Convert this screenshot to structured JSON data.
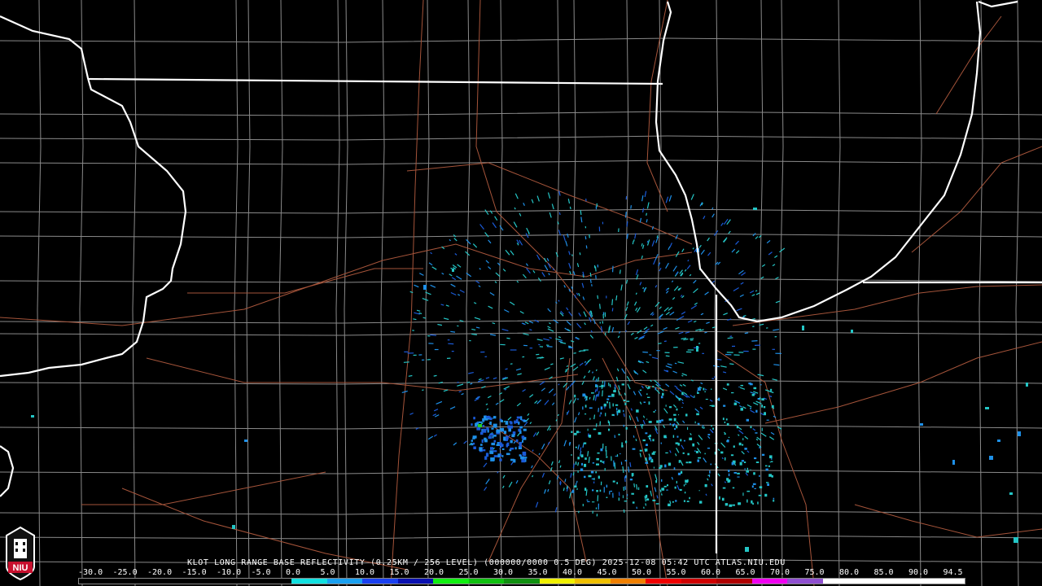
{
  "title": "KLOT LONG RANGE BASE REFLECTIVITY (0.25KM / 256 LEVEL) (000000/0000 0.5 DEG) 2025-12-08 05:42 UTC  ATLAS.NIU.EDU",
  "logo": {
    "text": "NIU",
    "color": "#c8102e"
  },
  "scale": {
    "labels": [
      "-30.0",
      "-25.0",
      "-20.0",
      "-15.0",
      "-10.0",
      "-5.0",
      "0.0",
      "5.0",
      "10.0",
      "15.0",
      "20.0",
      "25.0",
      "30.0",
      "35.0",
      "40.0",
      "45.0",
      "50.0",
      "55.0",
      "60.0",
      "65.0",
      "70.0",
      "75.0",
      "80.0",
      "85.0",
      "90.0",
      "94.5"
    ],
    "colors": [
      "#000000",
      "#000000",
      "#000000",
      "#000000",
      "#000000",
      "#000000",
      "#11e0e0",
      "#1aa0f0",
      "#1a40f0",
      "#0a10b0",
      "#10f010",
      "#10c010",
      "#109010",
      "#f0f000",
      "#f0c000",
      "#f08000",
      "#f00000",
      "#d00000",
      "#b00000",
      "#f000f0",
      "#9050d0",
      "#ffffff",
      "#ffffff",
      "#ffffff",
      "#ffffff"
    ]
  },
  "colors": {
    "state_border": "#ffffff",
    "county_border": "#8a8a8a",
    "highway": "#a5543a",
    "echo_light": "#24c6c6",
    "echo_mid": "#1e90e8",
    "echo_strong": "#1a5ad8",
    "echo_green": "#28d028"
  }
}
